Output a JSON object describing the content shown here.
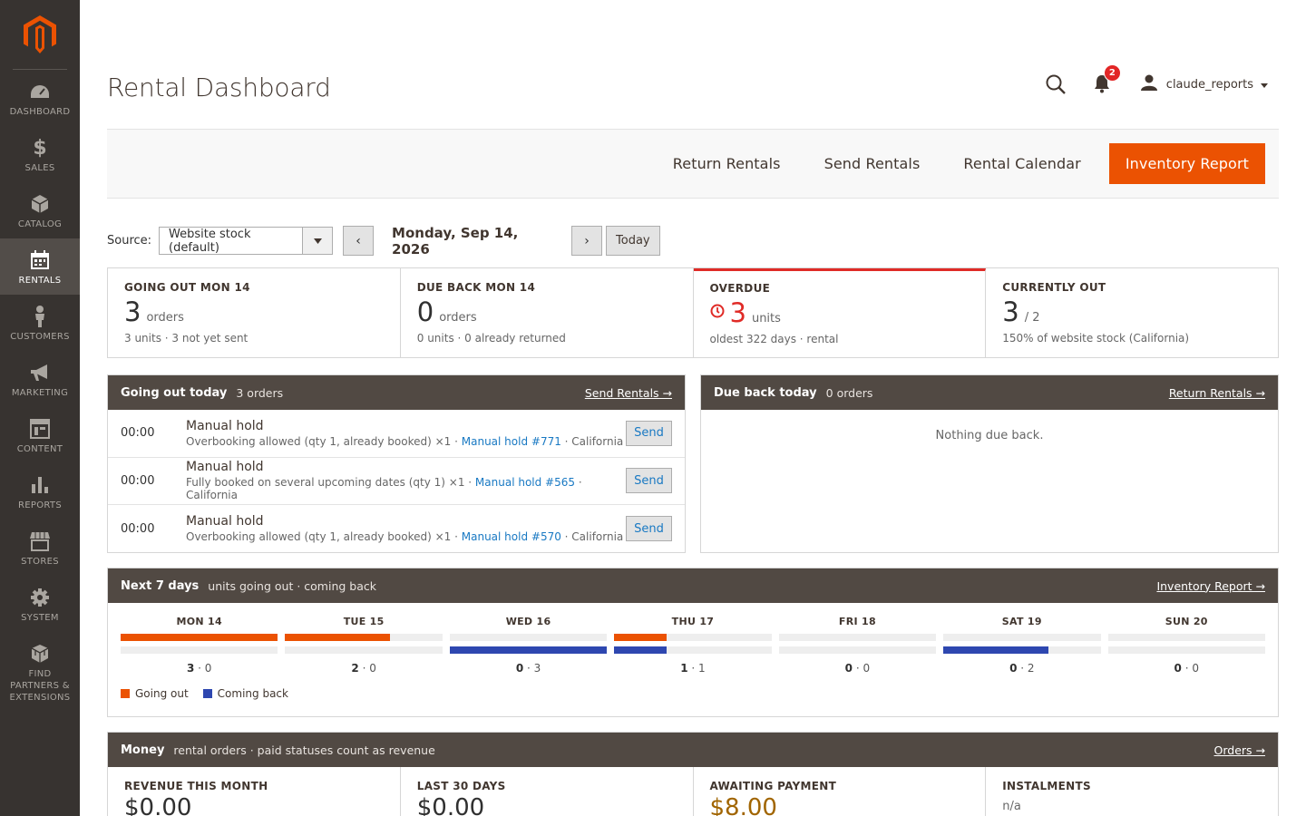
{
  "colors": {
    "accent": "#eb5202",
    "sidebar": "#373330",
    "panel_head": "#514943",
    "overdue": "#e02b27",
    "going_out": "#eb5202",
    "coming_back": "#2e47b0",
    "awaiting": "#a16500"
  },
  "sidebar": {
    "items": [
      {
        "label": "DASHBOARD",
        "icon": "dashboard-icon"
      },
      {
        "label": "SALES",
        "icon": "dollar-icon"
      },
      {
        "label": "CATALOG",
        "icon": "box-icon"
      },
      {
        "label": "RENTALS",
        "icon": "calendar-icon"
      },
      {
        "label": "CUSTOMERS",
        "icon": "person-icon"
      },
      {
        "label": "MARKETING",
        "icon": "megaphone-icon"
      },
      {
        "label": "CONTENT",
        "icon": "layout-icon"
      },
      {
        "label": "REPORTS",
        "icon": "bar-chart-icon"
      },
      {
        "label": "STORES",
        "icon": "store-icon"
      },
      {
        "label": "SYSTEM",
        "icon": "gear-icon"
      },
      {
        "label": "FIND\nPARTNERS &\nEXTENSIONS",
        "icon": "cube-icon"
      }
    ]
  },
  "header": {
    "title": "Rental Dashboard",
    "notifications": "2",
    "username": "claude_reports"
  },
  "actions": {
    "return": "Return Rentals",
    "send": "Send Rentals",
    "calendar": "Rental Calendar",
    "inventory": "Inventory Report"
  },
  "toolbar": {
    "source_label": "Source:",
    "source_value": "Website stock (default)",
    "prev": "‹",
    "next": "›",
    "date": "Monday, Sep 14, 2026",
    "today": "Today"
  },
  "stats": [
    {
      "label": "GOING OUT MON 14",
      "num": "3",
      "unit": "orders",
      "sub": "3 units · 3 not yet sent"
    },
    {
      "label": "DUE BACK MON 14",
      "num": "0",
      "unit": "orders",
      "sub": "0 units · 0 already returned"
    },
    {
      "label": "OVERDUE",
      "num": "3",
      "unit": "units",
      "sub": "oldest 322 days · rental"
    },
    {
      "label": "CURRENTLY OUT",
      "num": "3",
      "unit": "/ 2",
      "sub": "150% of website stock (California)"
    }
  ],
  "going_out": {
    "title": "Going out today",
    "sub": "3 orders",
    "link": "Send Rentals →",
    "rows": [
      {
        "time": "00:00",
        "title": "Manual hold",
        "desc": "Overbooking allowed (qty 1, already booked) ×1 · ",
        "link": "Manual hold #771",
        "tail": " · California",
        "btn": "Send"
      },
      {
        "time": "00:00",
        "title": "Manual hold",
        "desc": "Fully booked on several upcoming dates (qty 1) ×1 · ",
        "link": "Manual hold #565",
        "tail": " · California",
        "btn": "Send"
      },
      {
        "time": "00:00",
        "title": "Manual hold",
        "desc": "Overbooking allowed (qty 1, already booked) ×1 · ",
        "link": "Manual hold #570",
        "tail": " · California",
        "btn": "Send"
      }
    ]
  },
  "due_back": {
    "title": "Due back today",
    "sub": "0 orders",
    "link": "Return Rentals →",
    "empty": "Nothing due back."
  },
  "week": {
    "title": "Next 7 days",
    "sub": "units going out · coming back",
    "link": "Inventory Report →",
    "max": 3,
    "days": [
      {
        "label": "MON 14",
        "out": 3,
        "back": 0
      },
      {
        "label": "TUE 15",
        "out": 2,
        "back": 0
      },
      {
        "label": "WED 16",
        "out": 0,
        "back": 3
      },
      {
        "label": "THU 17",
        "out": 1,
        "back": 1
      },
      {
        "label": "FRI 18",
        "out": 0,
        "back": 0
      },
      {
        "label": "SAT 19",
        "out": 0,
        "back": 2
      },
      {
        "label": "SUN 20",
        "out": 0,
        "back": 0
      }
    ],
    "legend_out": "Going out",
    "legend_back": "Coming back"
  },
  "money": {
    "title": "Money",
    "sub": "rental orders · paid statuses count as revenue",
    "link": "Orders →",
    "stats": [
      {
        "label": "REVENUE THIS MONTH",
        "value": "$0.00"
      },
      {
        "label": "LAST 30 DAYS",
        "value": "$0.00"
      },
      {
        "label": "AWAITING PAYMENT",
        "value": "$8.00"
      },
      {
        "label": "INSTALMENTS",
        "value": "n/a"
      }
    ]
  }
}
